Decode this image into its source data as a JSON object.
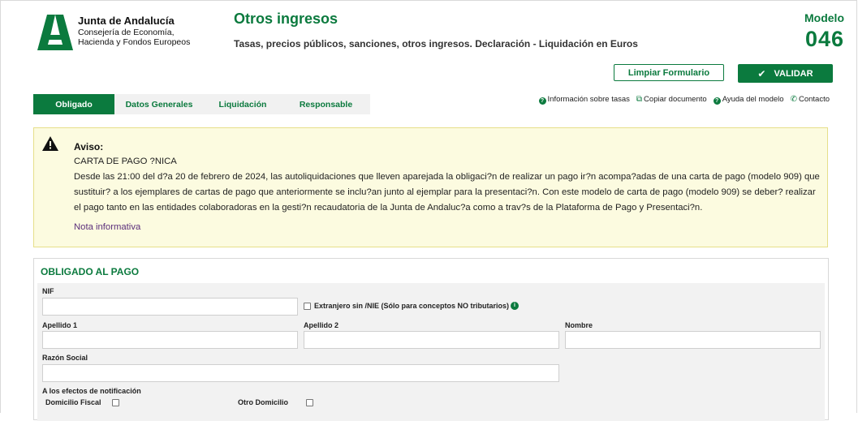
{
  "header": {
    "org_name": "Junta de Andalucía",
    "org_sub_1": "Consejería de Economía,",
    "org_sub_2": "Hacienda y Fondos Europeos",
    "title": "Otros ingresos",
    "subtitle": "Tasas, precios públicos, sanciones, otros ingresos. Declaración - Liquidación en Euros",
    "modelo_label": "Modelo",
    "modelo_number": "046"
  },
  "actions": {
    "clear_label": "Limpiar Formulario",
    "validate_label": "VALIDAR"
  },
  "tabs": [
    {
      "label": "Obligado",
      "active": true
    },
    {
      "label": "Datos Generales",
      "active": false
    },
    {
      "label": "Liquidación",
      "active": false
    },
    {
      "label": "Responsable",
      "active": false
    }
  ],
  "links": [
    {
      "label": "Información sobre tasas",
      "icon": "help-circle-icon"
    },
    {
      "label": "Copiar documento",
      "icon": "copy-icon"
    },
    {
      "label": "Ayuda del modelo",
      "icon": "help-circle-icon"
    },
    {
      "label": "Contacto",
      "icon": "phone-icon"
    }
  ],
  "notice": {
    "title": "Aviso:",
    "line1": "CARTA DE PAGO ?NICA",
    "body": "Desde las 21:00 del d?a 20 de febrero de 2024, las autoliquidaciones que lleven aparejada la obligaci?n de realizar un pago ir?n acompa?adas de una carta de pago (modelo 909) que sustituir? a los ejemplares de cartas de pago que anteriormente se inclu?an junto al ejemplar para la presentaci?n. Con este modelo de carta de pago (modelo 909) se deber? realizar el pago tanto en las entidades colaboradoras en la gesti?n recaudatoria de la Junta de Andaluc?a como a trav?s de la Plataforma de Pago y Presentaci?n.",
    "link": "Nota informativa"
  },
  "form": {
    "section_title": "OBLIGADO AL PAGO",
    "nif_label": "NIF",
    "nif_value": "",
    "extranjero_label": "Extranjero sin /NIE (Sólo para conceptos NO tributarios)",
    "apellido1_label": "Apellido 1",
    "apellido2_label": "Apellido 2",
    "nombre_label": "Nombre",
    "razon_social_label": "Razón Social",
    "notificacion_label": "A los efectos de notificación",
    "domicilio_fiscal_label": "Domicilio Fiscal",
    "otro_domicilio_label": "Otro Domicilio"
  },
  "colors": {
    "brand_green": "#0b7a3e",
    "notice_bg": "#fcfbe0",
    "notice_border": "#e6df8a"
  }
}
